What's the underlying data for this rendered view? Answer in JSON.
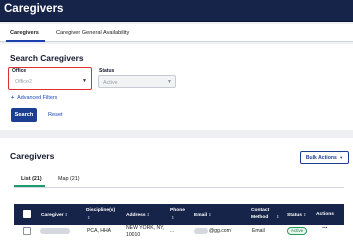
{
  "header": {
    "title": "Caregivers"
  },
  "tabs": [
    {
      "label": "Caregivers",
      "active": true
    },
    {
      "label": "Caregiver General Availability",
      "active": false
    }
  ],
  "search": {
    "heading": "Search Caregivers",
    "office": {
      "label": "Office",
      "value": "Office2"
    },
    "status": {
      "label": "Status",
      "value": "Active"
    },
    "advanced_filters": "Advanced Filters",
    "search_button": "Search",
    "reset_link": "Reset"
  },
  "list": {
    "heading": "Caregivers",
    "bulk_actions": "Bulk Actions",
    "views": [
      {
        "label": "List (21)",
        "active": true
      },
      {
        "label": "Map (21)",
        "active": false
      }
    ],
    "columns": [
      {
        "label": "Caregiver",
        "sortable": true
      },
      {
        "label": "Discipline(s)",
        "sortable": true
      },
      {
        "label": "Address",
        "sortable": true
      },
      {
        "label": "Phone",
        "sortable": true
      },
      {
        "label": "Email",
        "sortable": true
      },
      {
        "label": "Contact Method",
        "sortable": true
      },
      {
        "label": "Status",
        "sortable": true
      },
      {
        "label": "Actions",
        "sortable": false
      }
    ],
    "rows": [
      {
        "disciplines": "PCA, HHA",
        "address_line1": "NEW YORK, NY,",
        "address_line2": "10010",
        "phone": "...",
        "email": "@gg.com",
        "contact_method": "Email",
        "status": "Active"
      }
    ]
  },
  "colors": {
    "navy": "#16244a",
    "primary_button": "#1c3f92",
    "link": "#1c49b9",
    "tab_accent": "#1b3fae",
    "list_tab_accent": "#1b9c6c",
    "highlight_box": "#e0302e",
    "status_active": "#2a9a5e"
  }
}
